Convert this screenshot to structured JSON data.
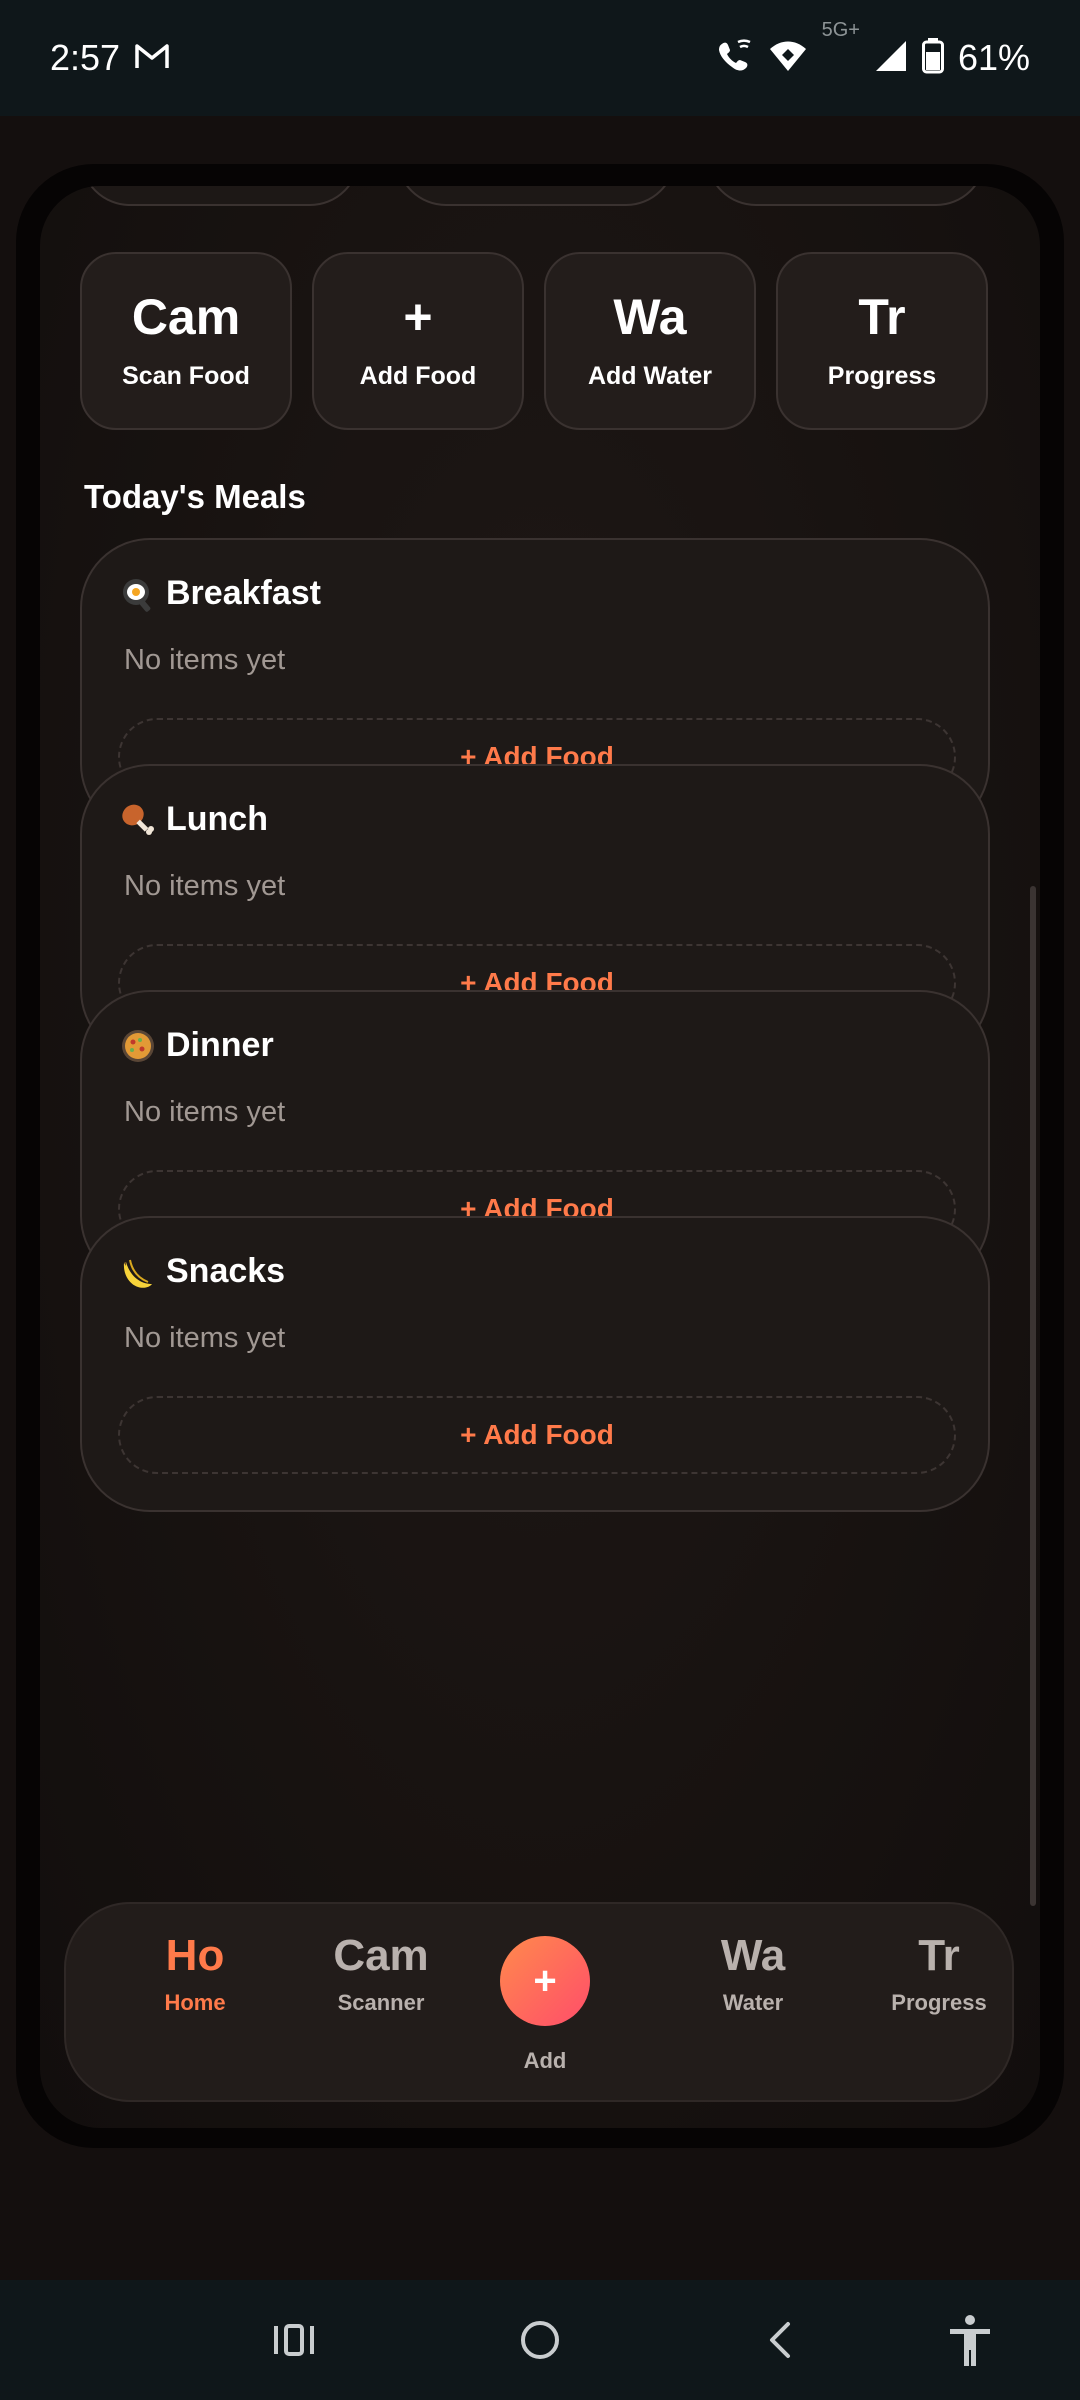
{
  "status_bar": {
    "time": "2:57",
    "network": "5G+",
    "battery": "61%"
  },
  "quick_actions": [
    {
      "icon": "Cam",
      "label": "Scan Food"
    },
    {
      "icon": "+",
      "label": "Add Food"
    },
    {
      "icon": "Wa",
      "label": "Add Water"
    },
    {
      "icon": "Tr",
      "label": "Progress"
    }
  ],
  "meals_section": {
    "title": "Today's Meals",
    "meals": [
      {
        "name": "Breakfast",
        "emoji": "fried-egg-icon",
        "empty_text": "No items yet",
        "add_label": "+ Add Food"
      },
      {
        "name": "Lunch",
        "emoji": "drumstick-icon",
        "empty_text": "No items yet",
        "add_label": "+ Add Food"
      },
      {
        "name": "Dinner",
        "emoji": "paella-pan-icon",
        "empty_text": "No items yet",
        "add_label": "+ Add Food"
      },
      {
        "name": "Snacks",
        "emoji": "banana-icon",
        "empty_text": "No items yet",
        "add_label": "+ Add Food"
      }
    ]
  },
  "bottom_nav": {
    "items": [
      {
        "icon": "Ho",
        "label": "Home",
        "active": true
      },
      {
        "icon": "Cam",
        "label": "Scanner",
        "active": false
      },
      {
        "icon": "+",
        "label": "Add",
        "active": false
      },
      {
        "icon": "Wa",
        "label": "Water",
        "active": false
      },
      {
        "icon": "Tr",
        "label": "Progress",
        "active": false
      }
    ]
  },
  "colors": {
    "accent": "#ff7a4a",
    "fab_gradient_start": "#ff8a4c",
    "fab_gradient_end": "#ff4d6a",
    "background": "#140f0e",
    "card": "#1e1917"
  }
}
